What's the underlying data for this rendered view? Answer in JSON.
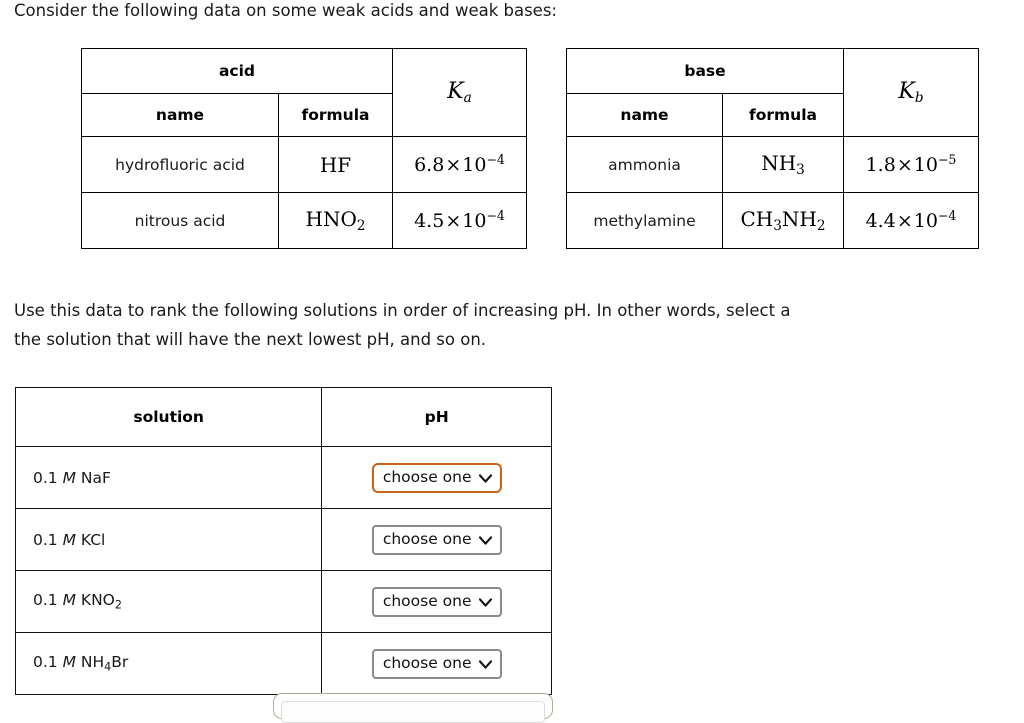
{
  "intro": {
    "text": "Consider the following data on some weak acids and weak bases:"
  },
  "acid_table": {
    "group_header": "acid",
    "col_name": "name",
    "col_formula": "formula",
    "constant_symbol": "K",
    "constant_subscript": "a",
    "rows": [
      {
        "name": "hydrofluoric acid",
        "formula_main": "HF",
        "formula_sub": "",
        "k_mantissa": "6.8",
        "k_times": "×",
        "k_base": "10",
        "k_exponent": "−4"
      },
      {
        "name": "nitrous acid",
        "formula_main": "HNO",
        "formula_sub": "2",
        "k_mantissa": "4.5",
        "k_times": "×",
        "k_base": "10",
        "k_exponent": "−4"
      }
    ]
  },
  "base_table": {
    "group_header": "base",
    "col_name": "name",
    "col_formula": "formula",
    "constant_symbol": "K",
    "constant_subscript": "b",
    "rows": [
      {
        "name": "ammonia",
        "formula_main": "NH",
        "formula_sub": "3",
        "k_mantissa": "1.8",
        "k_times": "×",
        "k_base": "10",
        "k_exponent": "−5"
      },
      {
        "name": "methylamine",
        "formula_part1": "CH",
        "formula_sub1": "3",
        "formula_part2": "NH",
        "formula_sub2": "2",
        "k_mantissa": "4.4",
        "k_times": "×",
        "k_base": "10",
        "k_exponent": "−4"
      }
    ]
  },
  "instructions": {
    "line1": "Use this data to rank the following solutions in order of increasing pH. In other words, select a",
    "line2": "the solution that will have the next lowest pH, and so on."
  },
  "solution_table": {
    "col_solution": "solution",
    "col_ph": "pH",
    "dropdown_label": "choose one",
    "chevron": "⌄",
    "focus_color": "#c8651a",
    "border_color": "#8a8a8a",
    "rows": [
      {
        "concentration": "0.1",
        "molarity": "M",
        "compound_part1": "NaF",
        "compound_sub1": "",
        "compound_part2": "",
        "compound_sub2": "",
        "ph_value": "choose one",
        "focused": true
      },
      {
        "concentration": "0.1",
        "molarity": "M",
        "compound_part1": "KCl",
        "compound_sub1": "",
        "compound_part2": "",
        "compound_sub2": "",
        "ph_value": "choose one",
        "focused": false
      },
      {
        "concentration": "0.1",
        "molarity": "M",
        "compound_part1": "KNO",
        "compound_sub1": "2",
        "compound_part2": "",
        "compound_sub2": "",
        "ph_value": "choose one",
        "focused": false
      },
      {
        "concentration": "0.1",
        "molarity": "M",
        "compound_part1": "NH",
        "compound_sub1": "4",
        "compound_part2": "Br",
        "compound_sub2": "",
        "ph_value": "choose one",
        "focused": false
      }
    ]
  }
}
